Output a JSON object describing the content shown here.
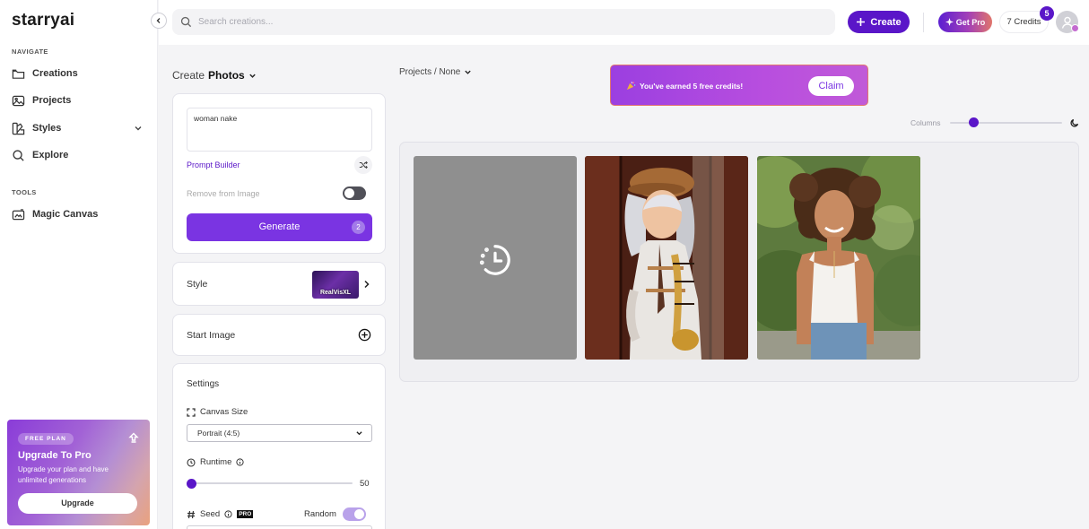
{
  "app": {
    "logo": "starryai"
  },
  "sidebar": {
    "navigate_heading": "NAVIGATE",
    "nav_items": [
      {
        "label": "Creations",
        "icon": "folder-icon"
      },
      {
        "label": "Projects",
        "icon": "image-icon"
      },
      {
        "label": "Styles",
        "icon": "palette-icon"
      },
      {
        "label": "Explore",
        "icon": "search-icon"
      }
    ],
    "tools_heading": "TOOLS",
    "tools_items": [
      {
        "label": "Magic Canvas",
        "icon": "canvas-icon"
      }
    ],
    "upgrade_card": {
      "badge": "FREE PLAN",
      "title": "Upgrade To Pro",
      "description": "Upgrade your plan and have unlimited generations",
      "button": "Upgrade"
    }
  },
  "topbar": {
    "search_placeholder": "Search creations...",
    "create_label": "Create",
    "get_pro_label": "Get Pro",
    "credits_label": "7 Credits",
    "notification_count": "5"
  },
  "create_panel": {
    "title_prefix": "Create",
    "title_type": "Photos",
    "prompt_value": "woman nake",
    "prompt_builder_label": "Prompt Builder",
    "remove_from_image_label": "Remove from Image",
    "remove_from_image_on": false,
    "generate_label": "Generate",
    "generate_cost": "2",
    "style_label": "Style",
    "style_name": "RealVisXL",
    "start_image_label": "Start Image",
    "settings_title": "Settings",
    "canvas_size_label": "Canvas Size",
    "canvas_size_value": "Portrait (4:5)",
    "runtime_label": "Runtime",
    "runtime_value": "50",
    "seed_label": "Seed",
    "pro_tag": "PRO",
    "random_label": "Random",
    "random_on": true
  },
  "main": {
    "breadcrumb": "Projects / None",
    "promo_message": "You've earned 5 free credits!",
    "claim_label": "Claim",
    "columns_label": "Columns",
    "gallery": [
      {
        "state": "generating",
        "icon": "clock-loading-icon"
      },
      {
        "state": "done",
        "description": "woman in white outfit and cap holding saxophone"
      },
      {
        "state": "done",
        "description": "smiling curly-haired woman in white tank top outdoors"
      }
    ]
  },
  "colors": {
    "primary": "#5a16c8",
    "generate": "#7a34e2",
    "promo": "#b84edf"
  }
}
